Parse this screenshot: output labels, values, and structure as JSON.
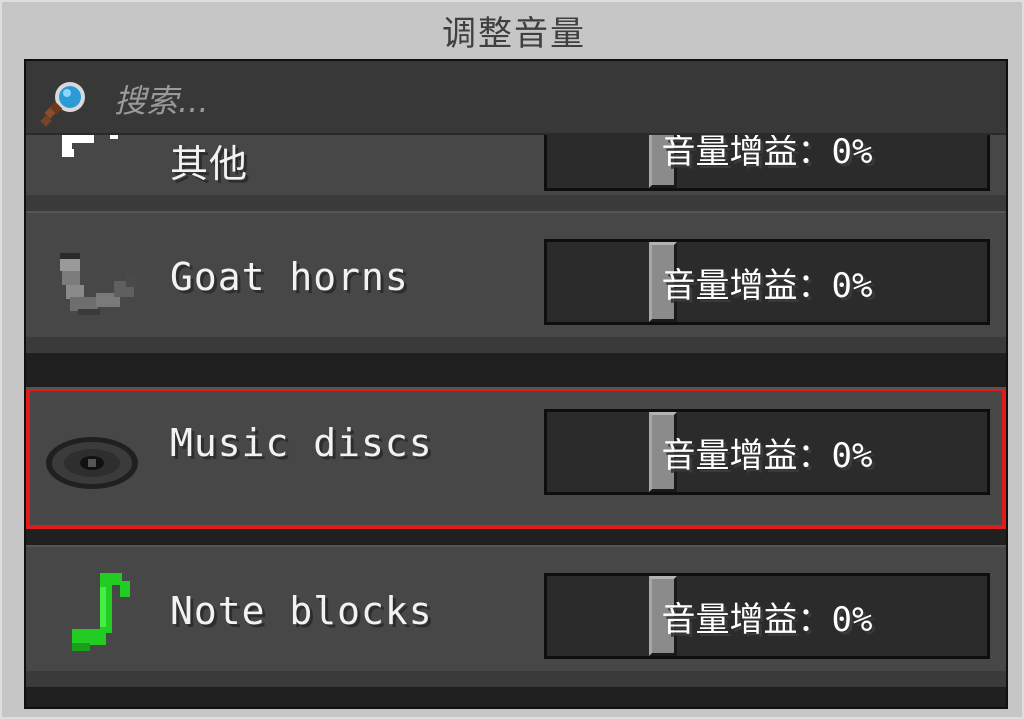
{
  "dialog": {
    "title": "调整音量"
  },
  "search": {
    "placeholder": "搜索..."
  },
  "rows": [
    {
      "label": "其他",
      "icon": "other-sounds-icon",
      "slider_text": "音量增益：0%",
      "gain_percent": 0
    },
    {
      "label": "Goat horns",
      "icon": "goat-horn-icon",
      "slider_text": "音量增益：0%",
      "gain_percent": 0
    },
    {
      "label": "Music discs",
      "icon": "music-disc-icon",
      "slider_text": "音量增益：0%",
      "gain_percent": 0,
      "selected": true
    },
    {
      "label": "Note blocks",
      "icon": "note-block-icon",
      "slider_text": "音量增益：0%",
      "gain_percent": 0
    }
  ],
  "colors": {
    "selection_outline": "#e01b1b",
    "row_background": "#474747",
    "note_icon": "#22cc22"
  }
}
